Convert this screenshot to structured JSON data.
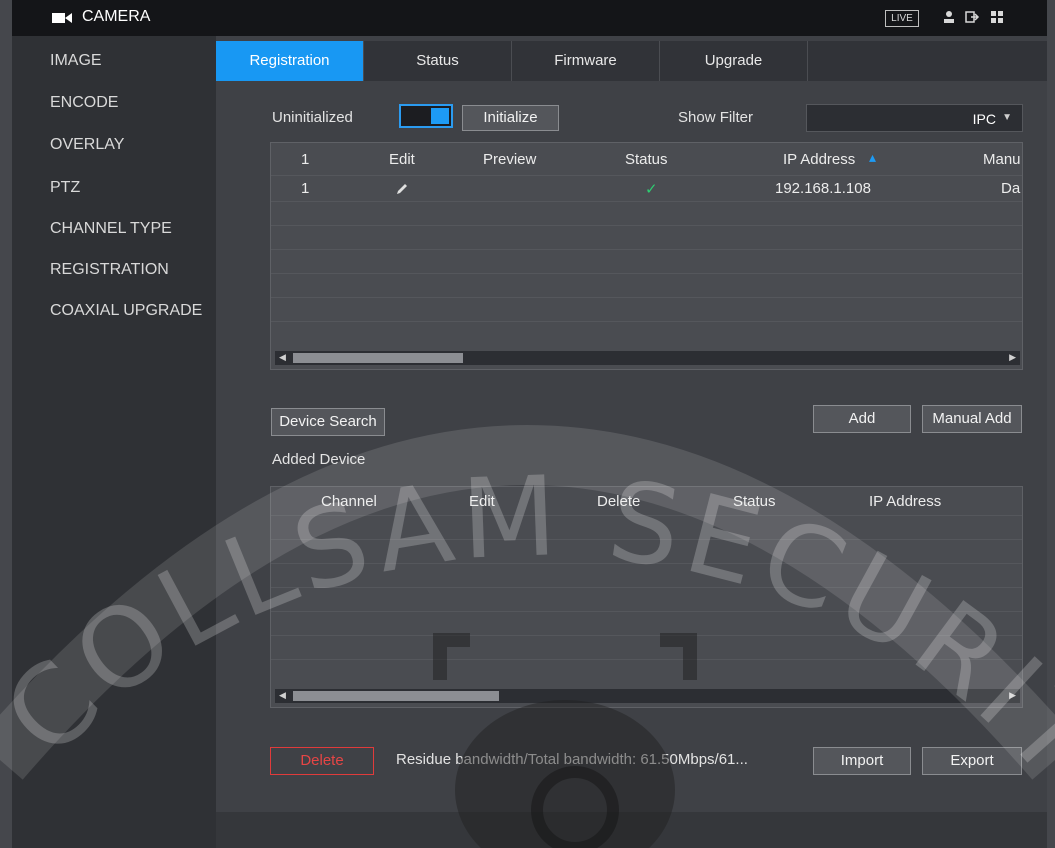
{
  "titlebar": {
    "title": "CAMERA",
    "live_label": "LIVE",
    "icons": [
      "camera-icon",
      "user-icon",
      "logout-icon",
      "menu-grid-icon"
    ]
  },
  "sidebar": {
    "items": [
      {
        "label": "IMAGE"
      },
      {
        "label": "ENCODE"
      },
      {
        "label": "OVERLAY"
      },
      {
        "label": "PTZ"
      },
      {
        "label": "CHANNEL TYPE"
      },
      {
        "label": "REGISTRATION"
      },
      {
        "label": "COAXIAL UPGRADE"
      }
    ]
  },
  "tabs": [
    {
      "label": "Registration",
      "active": true
    },
    {
      "label": "Status"
    },
    {
      "label": "Firmware"
    },
    {
      "label": "Upgrade"
    }
  ],
  "init": {
    "label": "Uninitialized",
    "initialize_button": "Initialize",
    "show_filter_label": "Show Filter",
    "filter_value": "IPC"
  },
  "search_table": {
    "headers": [
      "1",
      "Edit",
      "Preview",
      "Status",
      "IP Address",
      "Manu"
    ],
    "rows": [
      {
        "num": "1",
        "status": "✓",
        "ip": "192.168.1.108",
        "manufacturer": "Da"
      }
    ]
  },
  "actions": {
    "device_search": "Device Search",
    "add": "Add",
    "manual_add": "Manual Add"
  },
  "added": {
    "title": "Added Device",
    "headers": [
      "Channel",
      "Edit",
      "Delete",
      "Status",
      "IP Address"
    ]
  },
  "footer": {
    "delete": "Delete",
    "bandwidth": "Residue bandwidth/Total bandwidth:  61.50Mbps/61...",
    "import": "Import",
    "export": "Export"
  },
  "watermark": {
    "text": "COLLSAM SECURITY"
  },
  "colors": {
    "accent": "#1898f3",
    "danger": "#e03b3b",
    "check": "#2ecc71"
  }
}
